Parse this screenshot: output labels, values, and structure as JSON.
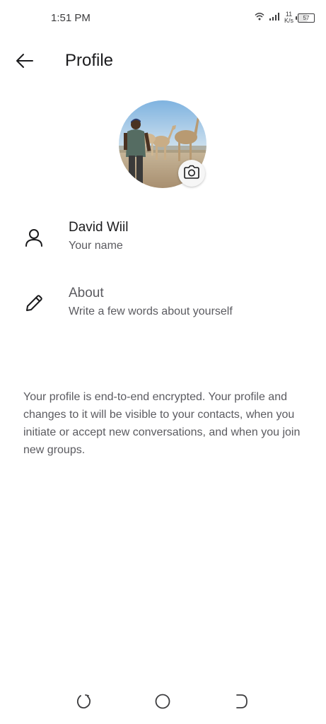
{
  "status_bar": {
    "time": "1:51 PM",
    "net_speed_value": "11",
    "net_speed_unit": "K/s",
    "battery_level": "57",
    "icons": [
      "wifi-icon",
      "signal-icon",
      "battery-icon"
    ]
  },
  "app_bar": {
    "title": "Profile",
    "back_icon": "arrow-left-icon"
  },
  "avatar": {
    "camera_icon": "camera-icon"
  },
  "profile": {
    "name_row": {
      "icon": "person-icon",
      "title": "David Wiil",
      "subtitle": "Your name"
    },
    "about_row": {
      "icon": "pencil-icon",
      "title": "About",
      "subtitle": "Write a few words about yourself"
    }
  },
  "info_text": "Your profile is end-to-end encrypted. Your profile and changes to it will be visible to your contacts, when you initiate or accept new conversations, and when you join new groups.",
  "nav_bar": {
    "icons": [
      "recents-icon",
      "home-icon",
      "back-icon"
    ]
  },
  "colors": {
    "text_primary": "#1b1b1d",
    "text_secondary": "#5b5b60",
    "background": "#ffffff"
  }
}
